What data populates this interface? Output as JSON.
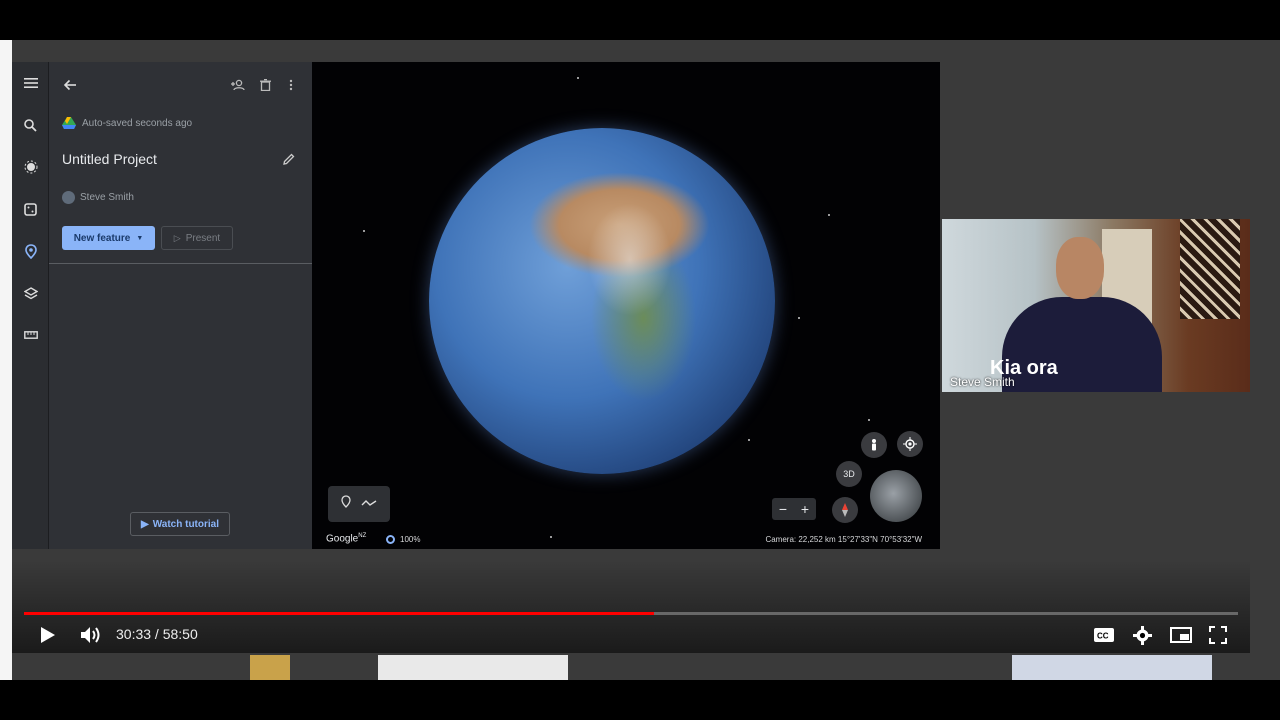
{
  "earth": {
    "autosave_text": "Auto-saved seconds ago",
    "project_title": "Untitled Project",
    "owner_name": "Steve Smith",
    "new_feature_label": "New feature",
    "present_label": "Present",
    "watch_tutorial_label": "Watch tutorial",
    "mode_3d_label": "3D",
    "google_logo": "Google",
    "google_logo_region": "NZ",
    "zoom_percent": "100%",
    "camera_info": "Camera: 22,252 km   15°27'33\"N 70°53'32\"W"
  },
  "webcam": {
    "shirt_text": "Kia ora",
    "name_label": "Steve Smith"
  },
  "player": {
    "current_time": "30:33",
    "duration": "58:50",
    "time_separator": " / ",
    "progress_fraction": 0.519
  },
  "colors": {
    "progress_played": "#ff0000",
    "accent_blue": "#8ab4f8"
  }
}
